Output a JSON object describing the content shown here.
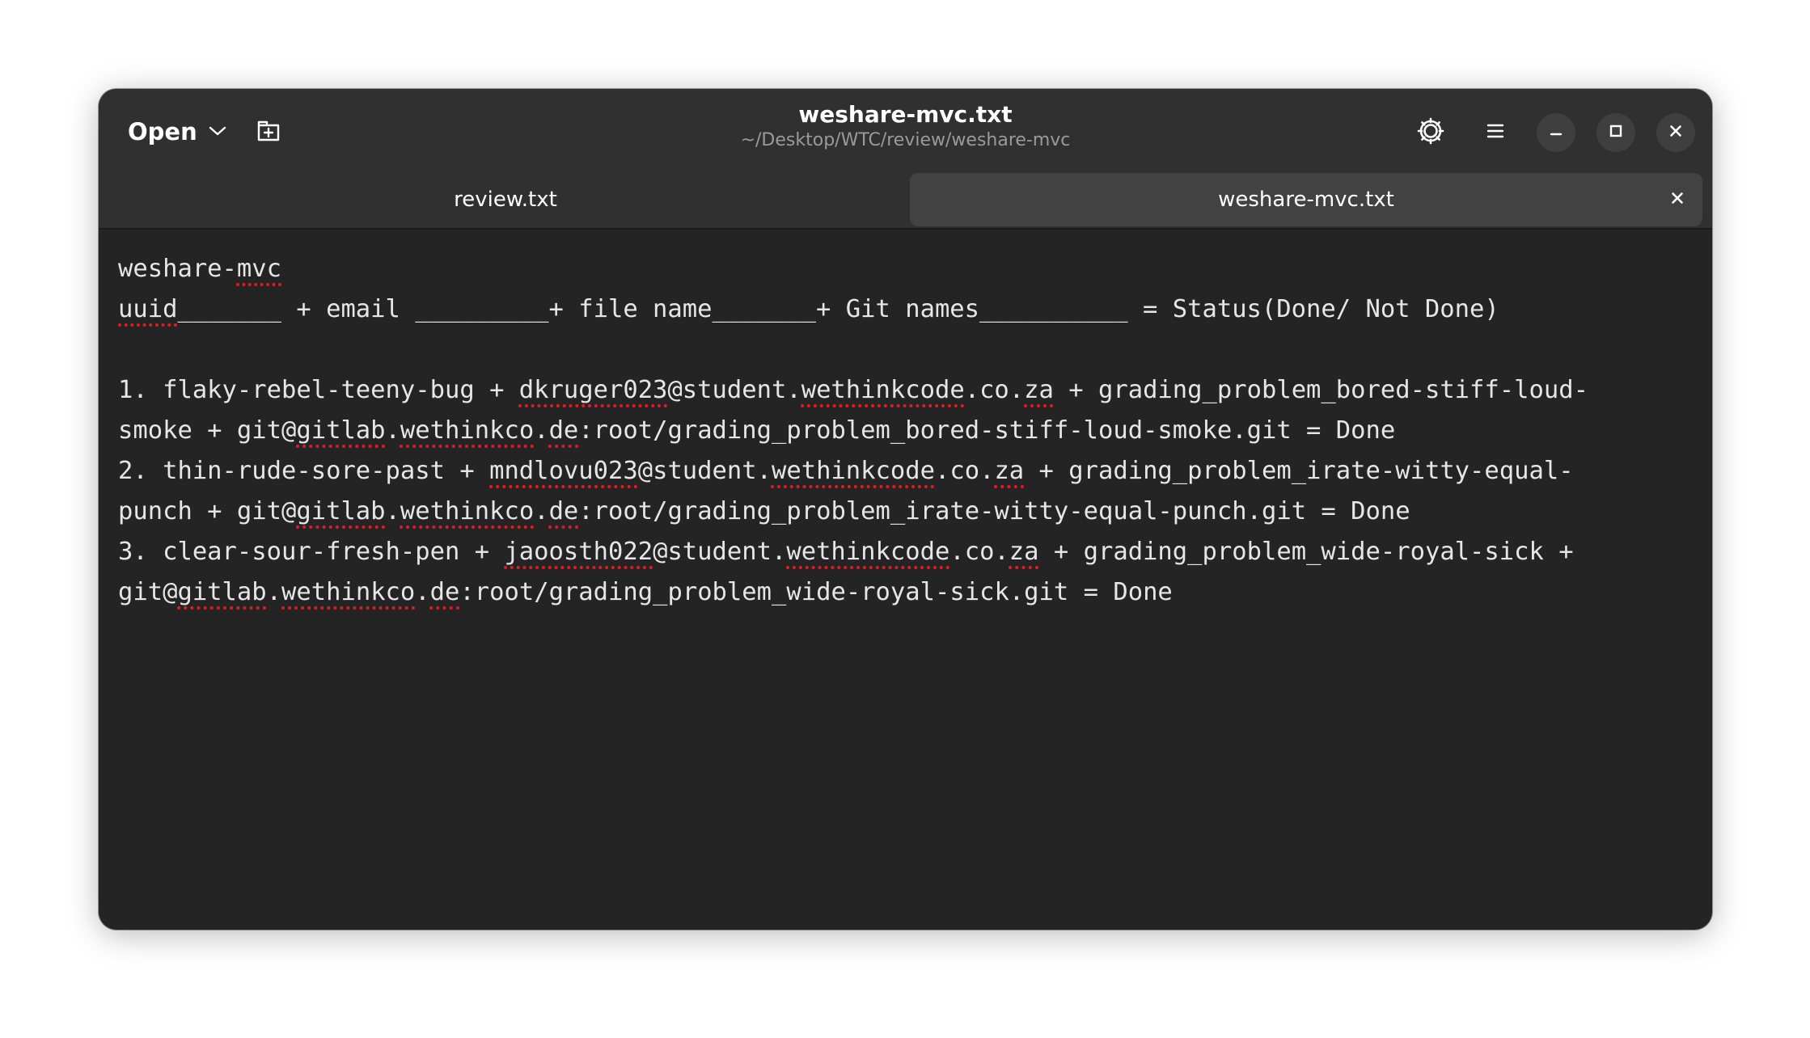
{
  "header": {
    "open_label": "Open",
    "title": "weshare-mvc.txt",
    "subtitle": "~/Desktop/WTC/review/weshare-mvc"
  },
  "tabs": [
    {
      "label": "review.txt",
      "active": false
    },
    {
      "label": "weshare-mvc.txt",
      "active": true
    }
  ],
  "icons": {
    "open_dropdown": "chevron-down-icon",
    "new_tab": "new-tab-icon",
    "settings": "gear-icon",
    "menu": "hamburger-menu-icon",
    "minimize": "minimize-icon",
    "maximize": "maximize-icon",
    "close": "close-icon",
    "tab_close": "close-icon"
  },
  "colors": {
    "window_bg": "#242424",
    "header_bg": "#303030",
    "active_tab_bg": "#424242",
    "spellcheck_underline": "#e01b24"
  },
  "document": {
    "lines": [
      [
        {
          "t": "weshare-"
        },
        {
          "t": "mvc",
          "s": true
        }
      ],
      [
        {
          "t": "uuid",
          "s": true
        },
        {
          "t": "_______ + email _________+ file name_______+ Git names__________ = Status(Done/ Not Done)"
        }
      ],
      [
        {
          "t": ""
        }
      ],
      [
        {
          "t": "1. flaky-rebel-teeny-bug + "
        },
        {
          "t": "dkruger023",
          "s": true
        },
        {
          "t": "@student."
        },
        {
          "t": "wethinkcode",
          "s": true
        },
        {
          "t": ".co."
        },
        {
          "t": "za",
          "s": true
        },
        {
          "t": " + grading_problem_bored-stiff-loud-"
        }
      ],
      [
        {
          "t": "smoke + git@"
        },
        {
          "t": "gitlab",
          "s": true
        },
        {
          "t": "."
        },
        {
          "t": "wethinkco",
          "s": true
        },
        {
          "t": "."
        },
        {
          "t": "de",
          "s": true
        },
        {
          "t": ":root/grading_problem_bored-stiff-loud-smoke.git = Done"
        }
      ],
      [
        {
          "t": "2. thin-rude-sore-past + "
        },
        {
          "t": "mndlovu023",
          "s": true
        },
        {
          "t": "@student."
        },
        {
          "t": "wethinkcode",
          "s": true
        },
        {
          "t": ".co."
        },
        {
          "t": "za",
          "s": true
        },
        {
          "t": " + grading_problem_irate-witty-equal-"
        }
      ],
      [
        {
          "t": "punch + git@"
        },
        {
          "t": "gitlab",
          "s": true
        },
        {
          "t": "."
        },
        {
          "t": "wethinkco",
          "s": true
        },
        {
          "t": "."
        },
        {
          "t": "de",
          "s": true
        },
        {
          "t": ":root/grading_problem_irate-witty-equal-punch.git = Done"
        }
      ],
      [
        {
          "t": "3. clear-sour-fresh-pen + "
        },
        {
          "t": "jaoosth022",
          "s": true
        },
        {
          "t": "@student."
        },
        {
          "t": "wethinkcode",
          "s": true
        },
        {
          "t": ".co."
        },
        {
          "t": "za",
          "s": true
        },
        {
          "t": " + grading_problem_wide-royal-sick +"
        }
      ],
      [
        {
          "t": "git@"
        },
        {
          "t": "gitlab",
          "s": true
        },
        {
          "t": "."
        },
        {
          "t": "wethinkco",
          "s": true
        },
        {
          "t": "."
        },
        {
          "t": "de",
          "s": true
        },
        {
          "t": ":root/grading_problem_wide-royal-sick.git = Done"
        }
      ]
    ]
  }
}
